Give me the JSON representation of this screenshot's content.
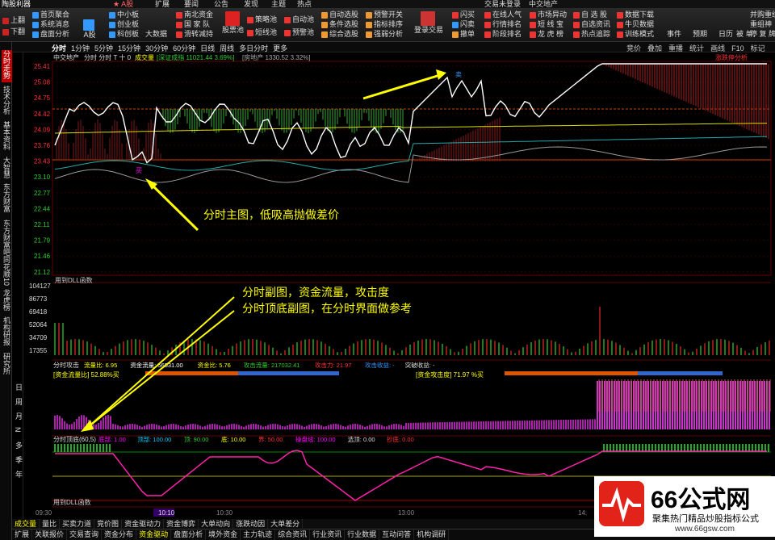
{
  "app": {
    "title": "陶股利器"
  },
  "menu": {
    "items": [
      "★ A股",
      "扩展",
      "要闻",
      "公告",
      "发现",
      "主题",
      "热点"
    ],
    "login": "交易未登录",
    "stock_top": "中交地产"
  },
  "toolbar": {
    "left_btns": [
      "上翻",
      "下翻"
    ],
    "col1": [
      "首页聚合",
      "系统消息",
      "盘面分析"
    ],
    "col2": [
      "A股",
      "中小板",
      "创业板",
      "科创板"
    ],
    "col3": [
      "大数据"
    ],
    "col4": [
      "南北资金",
      "国 家 队",
      "滑转减持"
    ],
    "col5": [
      "股票池"
    ],
    "col6": [
      "策略池",
      "短线池"
    ],
    "col7": [
      "自动池",
      "预警池"
    ],
    "col8": [
      "自动选股",
      "条件选股",
      "综合选股"
    ],
    "col9": [
      "预警开关",
      "指标排序",
      "强弱分析"
    ],
    "col10": [
      "登录交易"
    ],
    "col11": [
      "闪买",
      "闪卖",
      "撤单"
    ],
    "col12": [
      "在线人气",
      "行情排名",
      "阶段排名"
    ],
    "col13": [
      "市场异动",
      "短 线 宝",
      "龙 虎 榜"
    ],
    "col14": [
      "自 选 股",
      "自选资讯",
      "热点追踪"
    ],
    "col15": [
      "数据下载",
      "牛贝数据",
      "训练模式"
    ],
    "col16": [
      "事件",
      "预期"
    ],
    "col17": [
      "日历",
      "被 单"
    ],
    "col18": [
      "并购重组",
      "重组神",
      "停 复 牌"
    ]
  },
  "rightbtns": [
    "竞价",
    "叠加",
    "重播",
    "统计",
    "画线",
    "F10",
    "标记"
  ],
  "periods": [
    "分时",
    "1分钟",
    "5分钟",
    "15分钟",
    "30分钟",
    "60分钟",
    "日线",
    "周线",
    "多日分时",
    "更多"
  ],
  "leftnav": [
    "分时走势",
    "技术分析",
    "基本资料",
    "大智慧",
    "东方财富",
    "东方财富吧",
    "同花顺10",
    "龙虎榜",
    "机构研报",
    "研究所",
    "资讯"
  ],
  "leftnav2": [
    "日",
    "周",
    "月",
    "N",
    "多",
    "季",
    "年"
  ],
  "header": {
    "stock": "中交地产",
    "modes": "分时 分时 T 十 0",
    "vol_label": "成交量",
    "index": "[深证成指 11021.44 3.69%]",
    "sector": "[房地产 1330.52 3.32%]",
    "right_label": "涨跌停分析"
  },
  "price_axis": [
    "25.41",
    "25.08",
    "24.75",
    "24.42",
    "24.09",
    "23.76",
    "23.43",
    "23.10",
    "22.77",
    "22.44",
    "22.11",
    "21.79",
    "21.46",
    "21.12"
  ],
  "vol_axis": [
    "104127",
    "86773",
    "69418",
    "52064",
    "34709",
    "17355"
  ],
  "dll_label": "用到DLL函数",
  "panel2": {
    "title": "分时攻击",
    "items": [
      {
        "k": "流量比:",
        "v": "6.95"
      },
      {
        "k": "资金流量:",
        "v": "56531.00"
      },
      {
        "k": "资金比:",
        "v": "5.76"
      },
      {
        "k": "攻击流量:",
        "v": "217032.41"
      },
      {
        "k": "攻击力:",
        "v": "21.97"
      },
      {
        "k": "攻击收益:",
        "v": "-"
      },
      {
        "k": "突破收益:",
        "v": "-"
      }
    ],
    "left_tag": "[资金流量比] 52.88%买",
    "right_tag": "[资金攻击度] 71.97 %买"
  },
  "panel3": {
    "title": "分时顶底(60,5)",
    "items": [
      {
        "k": "底部:",
        "v": "1.00"
      },
      {
        "k": "顶部:",
        "v": "100.00"
      },
      {
        "k": "顶:",
        "v": "90.00"
      },
      {
        "k": "底:",
        "v": "10.00"
      },
      {
        "k": "界:",
        "v": "50.00"
      },
      {
        "k": "操盘线:",
        "v": "100.00"
      },
      {
        "k": "选顶:",
        "v": "0.00"
      },
      {
        "k": "抄底:",
        "v": "0.00"
      }
    ],
    "dll": "用到DLL函数"
  },
  "time_axis": [
    "09:30",
    "10:10",
    "10:30",
    "13:00",
    "14:"
  ],
  "notes": {
    "n1": "分时主图，低吸高抛做差价",
    "n2": "分时副图，资金流量，攻击度",
    "n3": "分时顶底副图，在分时界面做参考"
  },
  "tabs2": [
    "成交量",
    "量比",
    "买卖力道",
    "竞价图",
    "资金驱动力",
    "资金博弈",
    "大单动向",
    "涨跌动因",
    "大单差分"
  ],
  "tabs3": [
    "扩展",
    "关联报价",
    "交易查询",
    "资金分布",
    "资金驱动",
    "盘面分析",
    "境外资金",
    "主力轨迹",
    "综合资讯",
    "行业资讯",
    "行业数据",
    "互动问答",
    "机构调研"
  ],
  "watermark": {
    "big": "66公式网",
    "small": "聚集热门精品炒股指标公式",
    "url": "www.66gsw.com"
  },
  "buy_label": "买",
  "sell_label": "卖"
}
